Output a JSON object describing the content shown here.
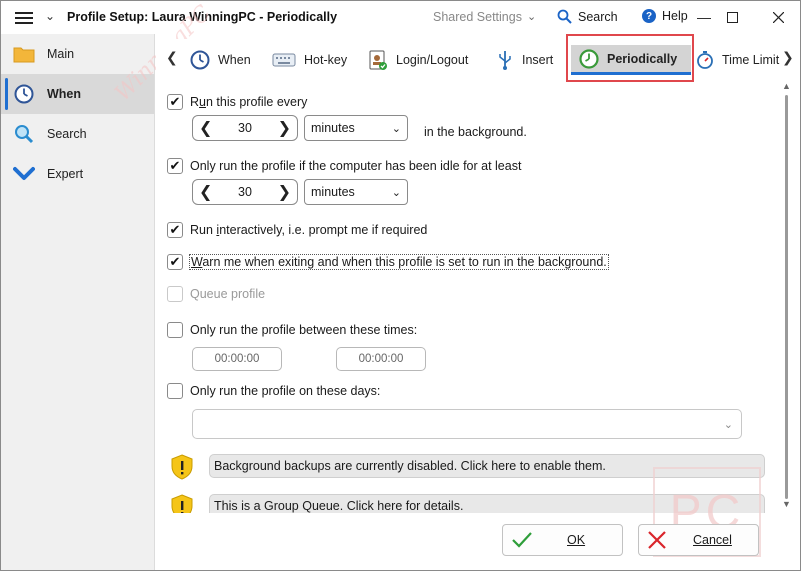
{
  "titlebar": {
    "title": "Profile Setup: Laura WinningPC - Periodically",
    "shared_settings": "Shared Settings",
    "search": "Search",
    "help": "Help"
  },
  "sidebar": {
    "items": [
      {
        "label": "Main",
        "icon": "folder-icon"
      },
      {
        "label": "When",
        "icon": "clock-icon",
        "active": true
      },
      {
        "label": "Search",
        "icon": "magnifier-icon"
      },
      {
        "label": "Expert",
        "icon": "chevron-down-icon"
      }
    ]
  },
  "tabs": [
    {
      "label": "When",
      "icon": "clock-icon"
    },
    {
      "label": "Hot-key",
      "icon": "keyboard-icon"
    },
    {
      "label": "Login/Logout",
      "icon": "user-badge-icon"
    },
    {
      "label": "Insert",
      "icon": "usb-icon"
    },
    {
      "label": "Periodically",
      "icon": "green-clock-icon",
      "selected": true
    },
    {
      "label": "Time Limit",
      "icon": "stopwatch-icon"
    }
  ],
  "options": {
    "run_every": {
      "checked": true,
      "pre": "R",
      "underline": "u",
      "post": "n this profile every",
      "value": "30",
      "unit": "minutes",
      "suffix": "in the background."
    },
    "idle": {
      "checked": true,
      "label": "Only run the profile if the computer has been idle for at least",
      "value": "30",
      "unit": "minutes"
    },
    "interactive": {
      "checked": true,
      "pre": "Run ",
      "underline": "i",
      "post": "nteractively, i.e. prompt me if required"
    },
    "warn": {
      "checked": true,
      "underline": "W",
      "post": "arn me when exiting and when this profile is set to run in the background."
    },
    "queue": {
      "checked": false,
      "disabled": true,
      "label": "Queue profile"
    },
    "between_times": {
      "checked": false,
      "label": "Only run the profile between these times:",
      "start": "00:00:00",
      "end": "00:00:00"
    },
    "days": {
      "checked": false,
      "label": "Only run the profile on these days:"
    }
  },
  "notices": {
    "backups_disabled": "Background backups are currently disabled. Click here to enable them.",
    "group_queue": "This is a Group Queue. Click here for details."
  },
  "buttons": {
    "ok": "OK",
    "cancel": "Cancel"
  },
  "colors": {
    "accent": "#1f6fd1",
    "highlight": "#e0474c",
    "ok_green": "#2e9e3a",
    "cancel_red": "#d9252b",
    "shield_yellow": "#f5c518"
  }
}
